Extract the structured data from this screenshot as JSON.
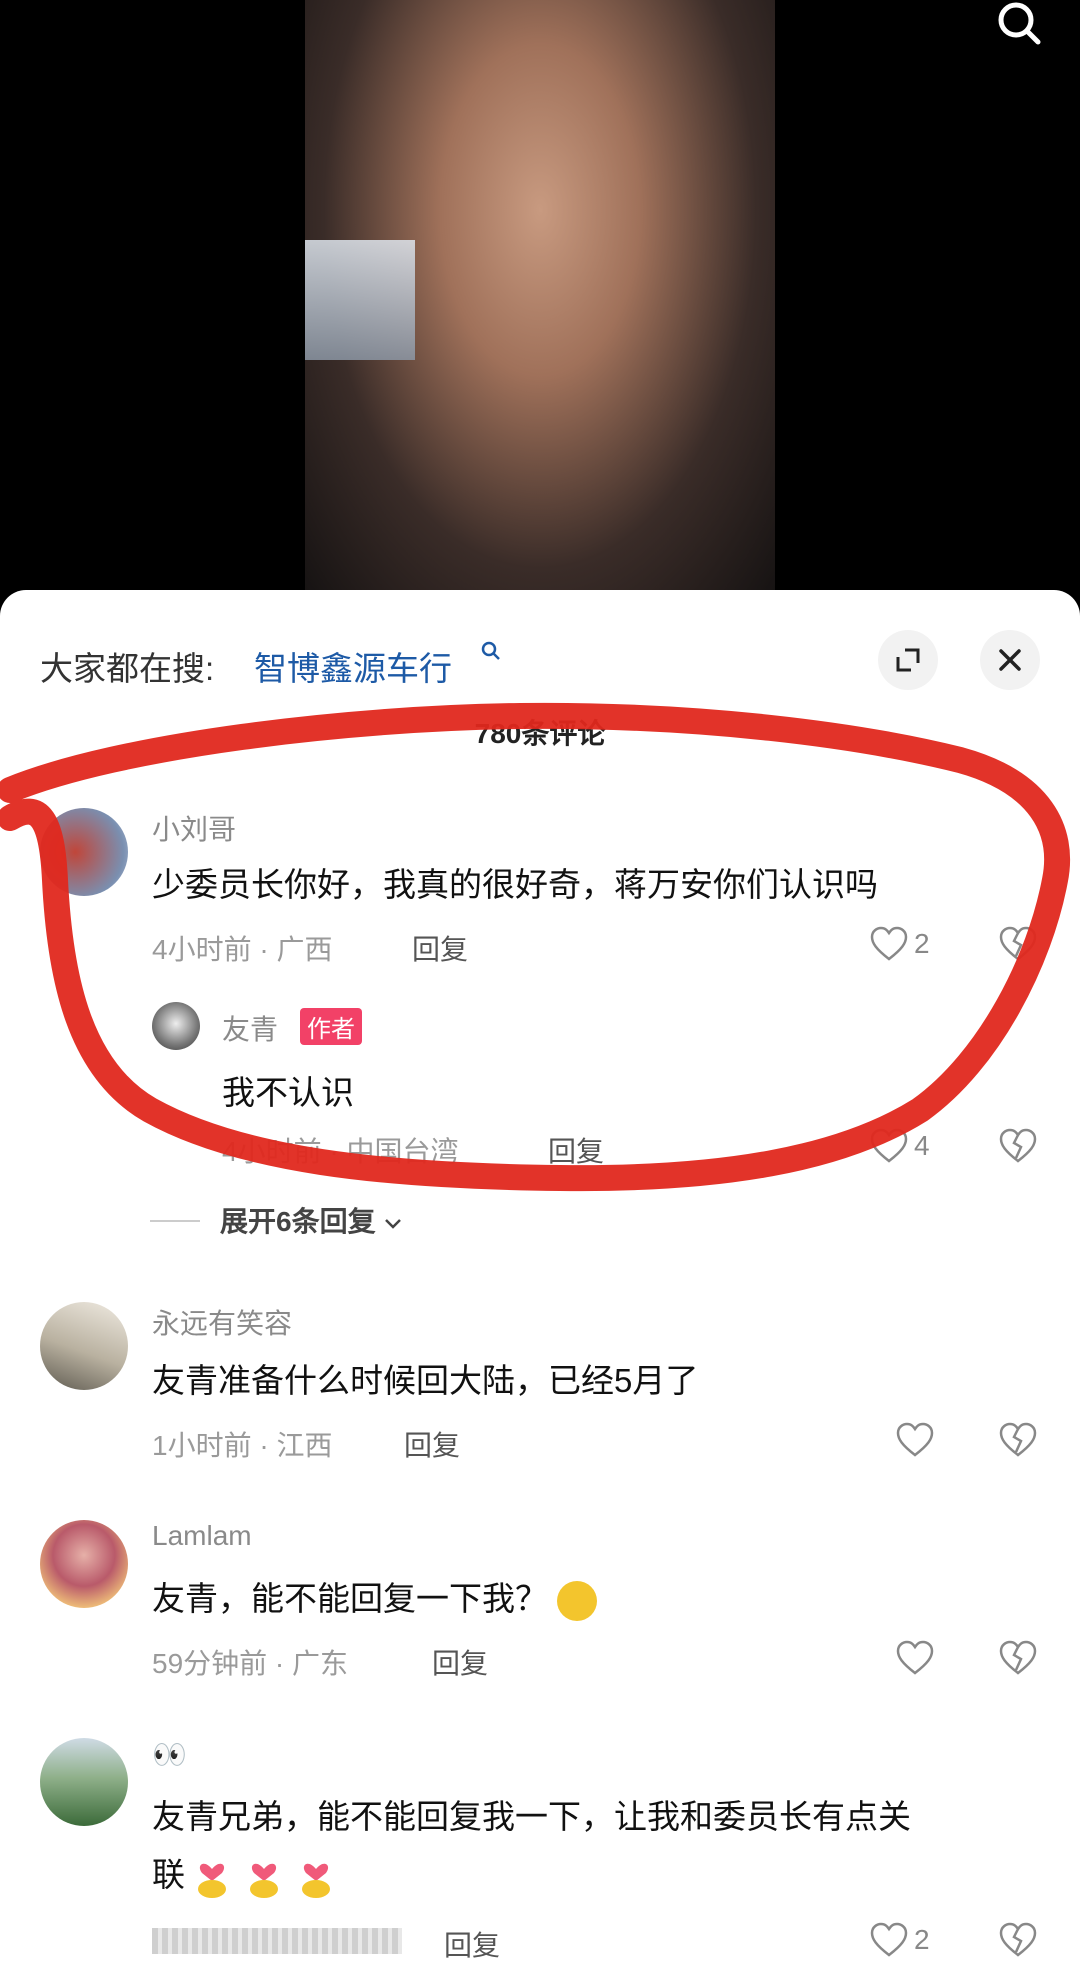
{
  "video": {
    "search_icon": "search-icon"
  },
  "sheet": {
    "suggest_prefix": "大家都在搜:",
    "suggest_query": "智博鑫源车行",
    "comment_count": "780条评论",
    "expand_icon": "expand-icon",
    "close_icon": "close-icon"
  },
  "comments": [
    {
      "user": "小刘哥",
      "text": "少委员长你好，我真的很好奇，蒋万安你们认识吗",
      "time_loc": "4小时前 · 广西",
      "reply": "回复",
      "likes": "2"
    },
    {
      "user": "友青",
      "badge": "作者",
      "text": "我不认识",
      "time_loc": "4小时前 · 中国台湾",
      "reply": "回复",
      "likes": "4"
    },
    {
      "user": "永远有笑容",
      "text": "友青准备什么时候回大陆，已经5月了",
      "time_loc": "1小时前 · 江西",
      "reply": "回复"
    },
    {
      "user": "Lamlam",
      "text": "友青，能不能回复一下我？",
      "time_loc": "59分钟前 · 广东",
      "reply": "回复"
    },
    {
      "user": "👀",
      "text_line1": "友青兄弟，能不能回复我一下，让我和委员长有点关",
      "text_line2": "联",
      "reply": "回复",
      "likes": "2"
    }
  ],
  "expand_replies": "展开6条回复",
  "annotation_color": "#e0281e"
}
